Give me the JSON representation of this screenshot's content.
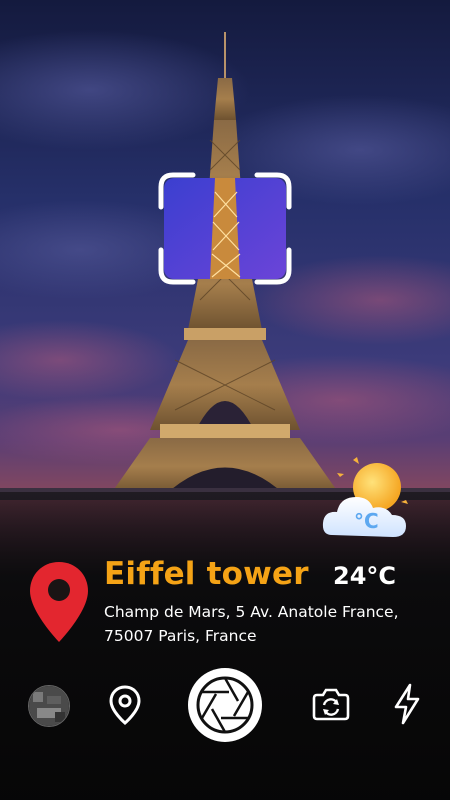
{
  "place": {
    "name": "Eiffel tower",
    "temperature": "24°C",
    "address_line1": "Champ de Mars, 5 Av. Anatole France,",
    "address_line2": "75007 Paris, France"
  },
  "colors": {
    "accent": "#f5a316",
    "pin": "#e3262f",
    "text": "#ffffff"
  },
  "icons": {
    "weather": "sun-cloud-icon",
    "pin": "map-pin-icon",
    "location": "location-pin-icon",
    "shutter": "camera-shutter-icon",
    "switch": "camera-switch-icon",
    "flash": "flash-icon"
  }
}
